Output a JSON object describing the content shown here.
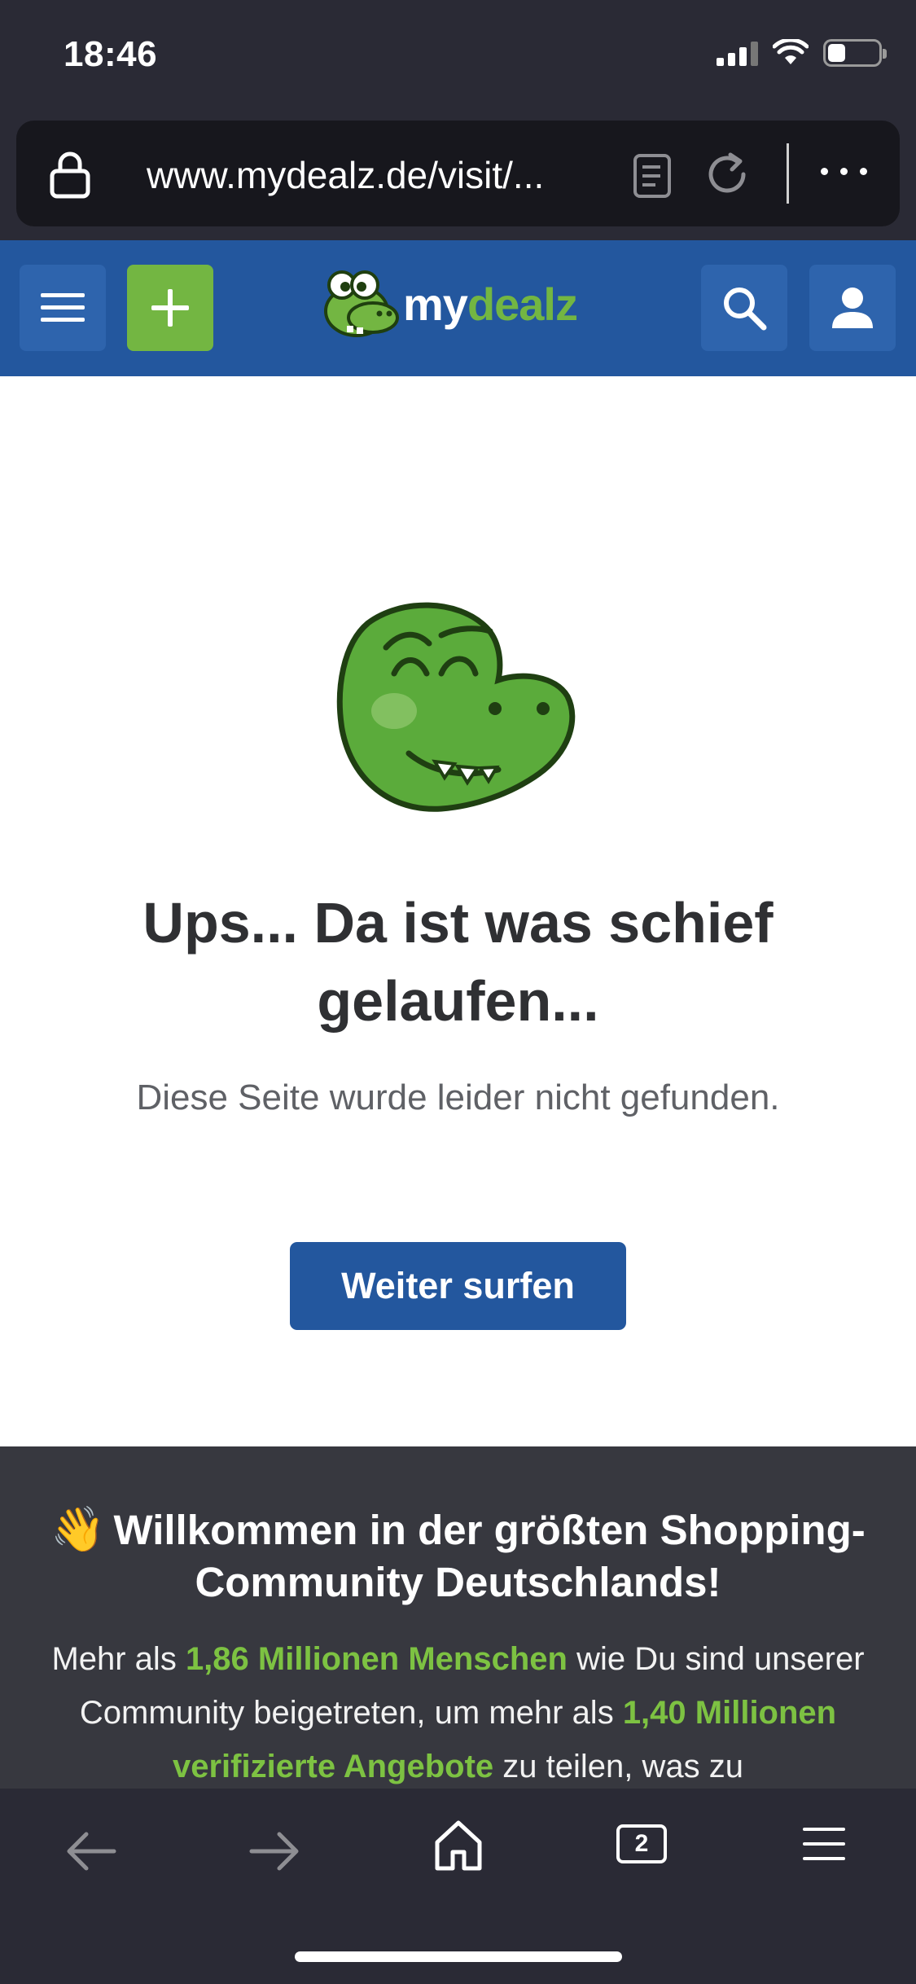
{
  "status": {
    "time": "18:46",
    "battery_level": 0.35
  },
  "browser": {
    "url": "www.mydealz.de/visit/...",
    "tab_count": "2",
    "icons": [
      "lock-icon",
      "reader-icon",
      "reload-icon",
      "more-icon",
      "back-icon",
      "forward-icon",
      "home-icon",
      "tabs-icon",
      "menu-icon"
    ]
  },
  "header": {
    "logo_my": "my",
    "logo_dealz": "dealz",
    "icons": [
      "hamburger-icon",
      "plus-icon",
      "search-icon",
      "user-icon"
    ]
  },
  "error": {
    "title": "Ups... Da ist was schief gelaufen...",
    "subtitle": "Diese Seite wurde leider nicht gefunden.",
    "button": "Weiter surfen"
  },
  "welcome": {
    "emoji": "👋",
    "title": "Willkommen in der größten Shopping-Community Deutschlands!",
    "text_1": "Mehr als ",
    "highlight_1": "1,86 Millionen Menschen",
    "text_2": " wie Du sind unserer Community beigetreten, um mehr als ",
    "highlight_2": "1,40 Millionen verifizierte Angebote",
    "text_3": " zu teilen, was zu"
  },
  "colors": {
    "brand_blue": "#23579e",
    "brand_green": "#73b642",
    "dark_panel": "#37383f",
    "browser_chrome": "#2a2a35"
  }
}
